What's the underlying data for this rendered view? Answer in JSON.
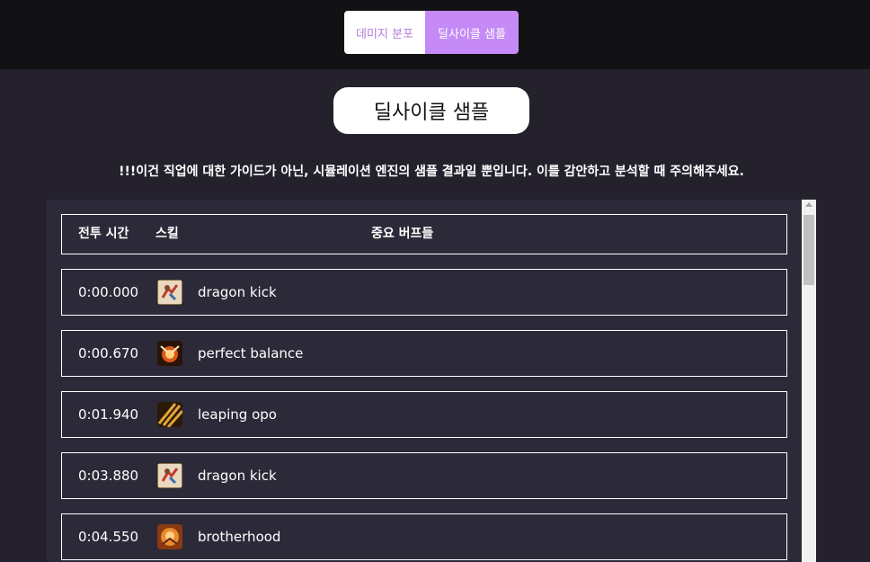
{
  "tabs": [
    {
      "label": "데미지 분포"
    },
    {
      "label": "딜사이클 샘플"
    }
  ],
  "page_title": "딜사이클 샘플",
  "notice": "!!!이건 직업에 대한 가이드가 아닌, 시뮬레이션 엔진의 샘플 결과일 뿐입니다. 이를 감안하고 분석할 때 주의해주세요.",
  "table": {
    "headers": {
      "time": "전투 시간",
      "skill": "스킬",
      "buffs": "중요 버프들"
    },
    "rows": [
      {
        "time": "0:00.000",
        "skill": "dragon kick",
        "icon": "dragon-kick-icon"
      },
      {
        "time": "0:00.670",
        "skill": "perfect balance",
        "icon": "perfect-balance-icon"
      },
      {
        "time": "0:01.940",
        "skill": "leaping opo",
        "icon": "leaping-opo-icon"
      },
      {
        "time": "0:03.880",
        "skill": "dragon kick",
        "icon": "dragon-kick-icon"
      },
      {
        "time": "0:04.550",
        "skill": "brotherhood",
        "icon": "brotherhood-icon"
      }
    ]
  },
  "colors": {
    "topbar": "#121114",
    "background": "#24212d",
    "panel": "#2c2938",
    "accent": "#c58af5",
    "accent_text": "#b87bd9"
  }
}
